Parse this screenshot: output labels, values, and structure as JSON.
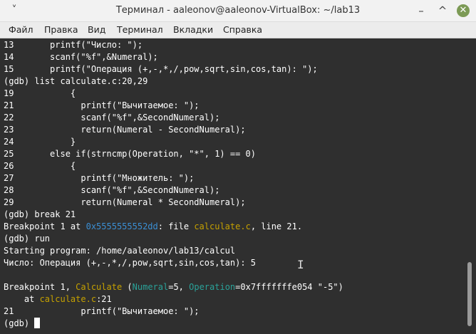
{
  "window": {
    "title": "Терминал - aaleonov@aaleonov-VirtualBox: ~/lab13",
    "minimize": "–",
    "maximize": "^",
    "close": "✕",
    "menu_chevron": "˅"
  },
  "menu": [
    "Файл",
    "Правка",
    "Вид",
    "Терминал",
    "Вкладки",
    "Справка"
  ],
  "terminal": {
    "lines": [
      [
        {
          "t": "13       printf(\"Число: \");"
        }
      ],
      [
        {
          "t": "14       scanf(\"%f\",&Numeral);"
        }
      ],
      [
        {
          "t": "15       printf(\"Операция (+,-,*,/,pow,sqrt,sin,cos,tan): \");"
        }
      ],
      [
        {
          "t": "(gdb) list calculate.c:20,29"
        }
      ],
      [
        {
          "t": "19           {"
        }
      ],
      [
        {
          "t": "21             printf(\"Вычитаемое: \");"
        }
      ],
      [
        {
          "t": "22             scanf(\"%f\",&SecondNumeral);"
        }
      ],
      [
        {
          "t": "23             return(Numeral - SecondNumeral);"
        }
      ],
      [
        {
          "t": "24           }"
        }
      ],
      [
        {
          "t": "25       else if(strncmp(Operation, \"*\", 1) == 0)"
        }
      ],
      [
        {
          "t": "26           {"
        }
      ],
      [
        {
          "t": "27             printf(\"Множитель: \");"
        }
      ],
      [
        {
          "t": "28             scanf(\"%f\",&SecondNumeral);"
        }
      ],
      [
        {
          "t": "29             return(Numeral * SecondNumeral);"
        }
      ],
      [
        {
          "t": "(gdb) break 21"
        }
      ],
      [
        {
          "t": "Breakpoint 1 at "
        },
        {
          "t": "0x5555555552dd",
          "c": "blue"
        },
        {
          "t": ": file "
        },
        {
          "t": "calculate.c",
          "c": "yellow"
        },
        {
          "t": ", line 21."
        }
      ],
      [
        {
          "t": "(gdb) run"
        }
      ],
      [
        {
          "t": "Starting program: /home/aaleonov/lab13/calcul"
        }
      ],
      [
        {
          "t": "Число: Операция (+,-,*,/,pow,sqrt,sin,cos,tan): 5"
        }
      ],
      [
        {
          "t": ""
        }
      ],
      [
        {
          "t": "Breakpoint 1, "
        },
        {
          "t": "Calculate",
          "c": "yellow"
        },
        {
          "t": " ("
        },
        {
          "t": "Numeral",
          "c": "cyan"
        },
        {
          "t": "=5, "
        },
        {
          "t": "Operation",
          "c": "cyan"
        },
        {
          "t": "=0x7fffffffe054 \"-5\")"
        }
      ],
      [
        {
          "t": "    at "
        },
        {
          "t": "calculate.c",
          "c": "yellow"
        },
        {
          "t": ":21"
        }
      ],
      [
        {
          "t": "21             printf(\"Вычитаемое: \");"
        }
      ],
      [
        {
          "t": "(gdb) "
        }
      ]
    ]
  }
}
